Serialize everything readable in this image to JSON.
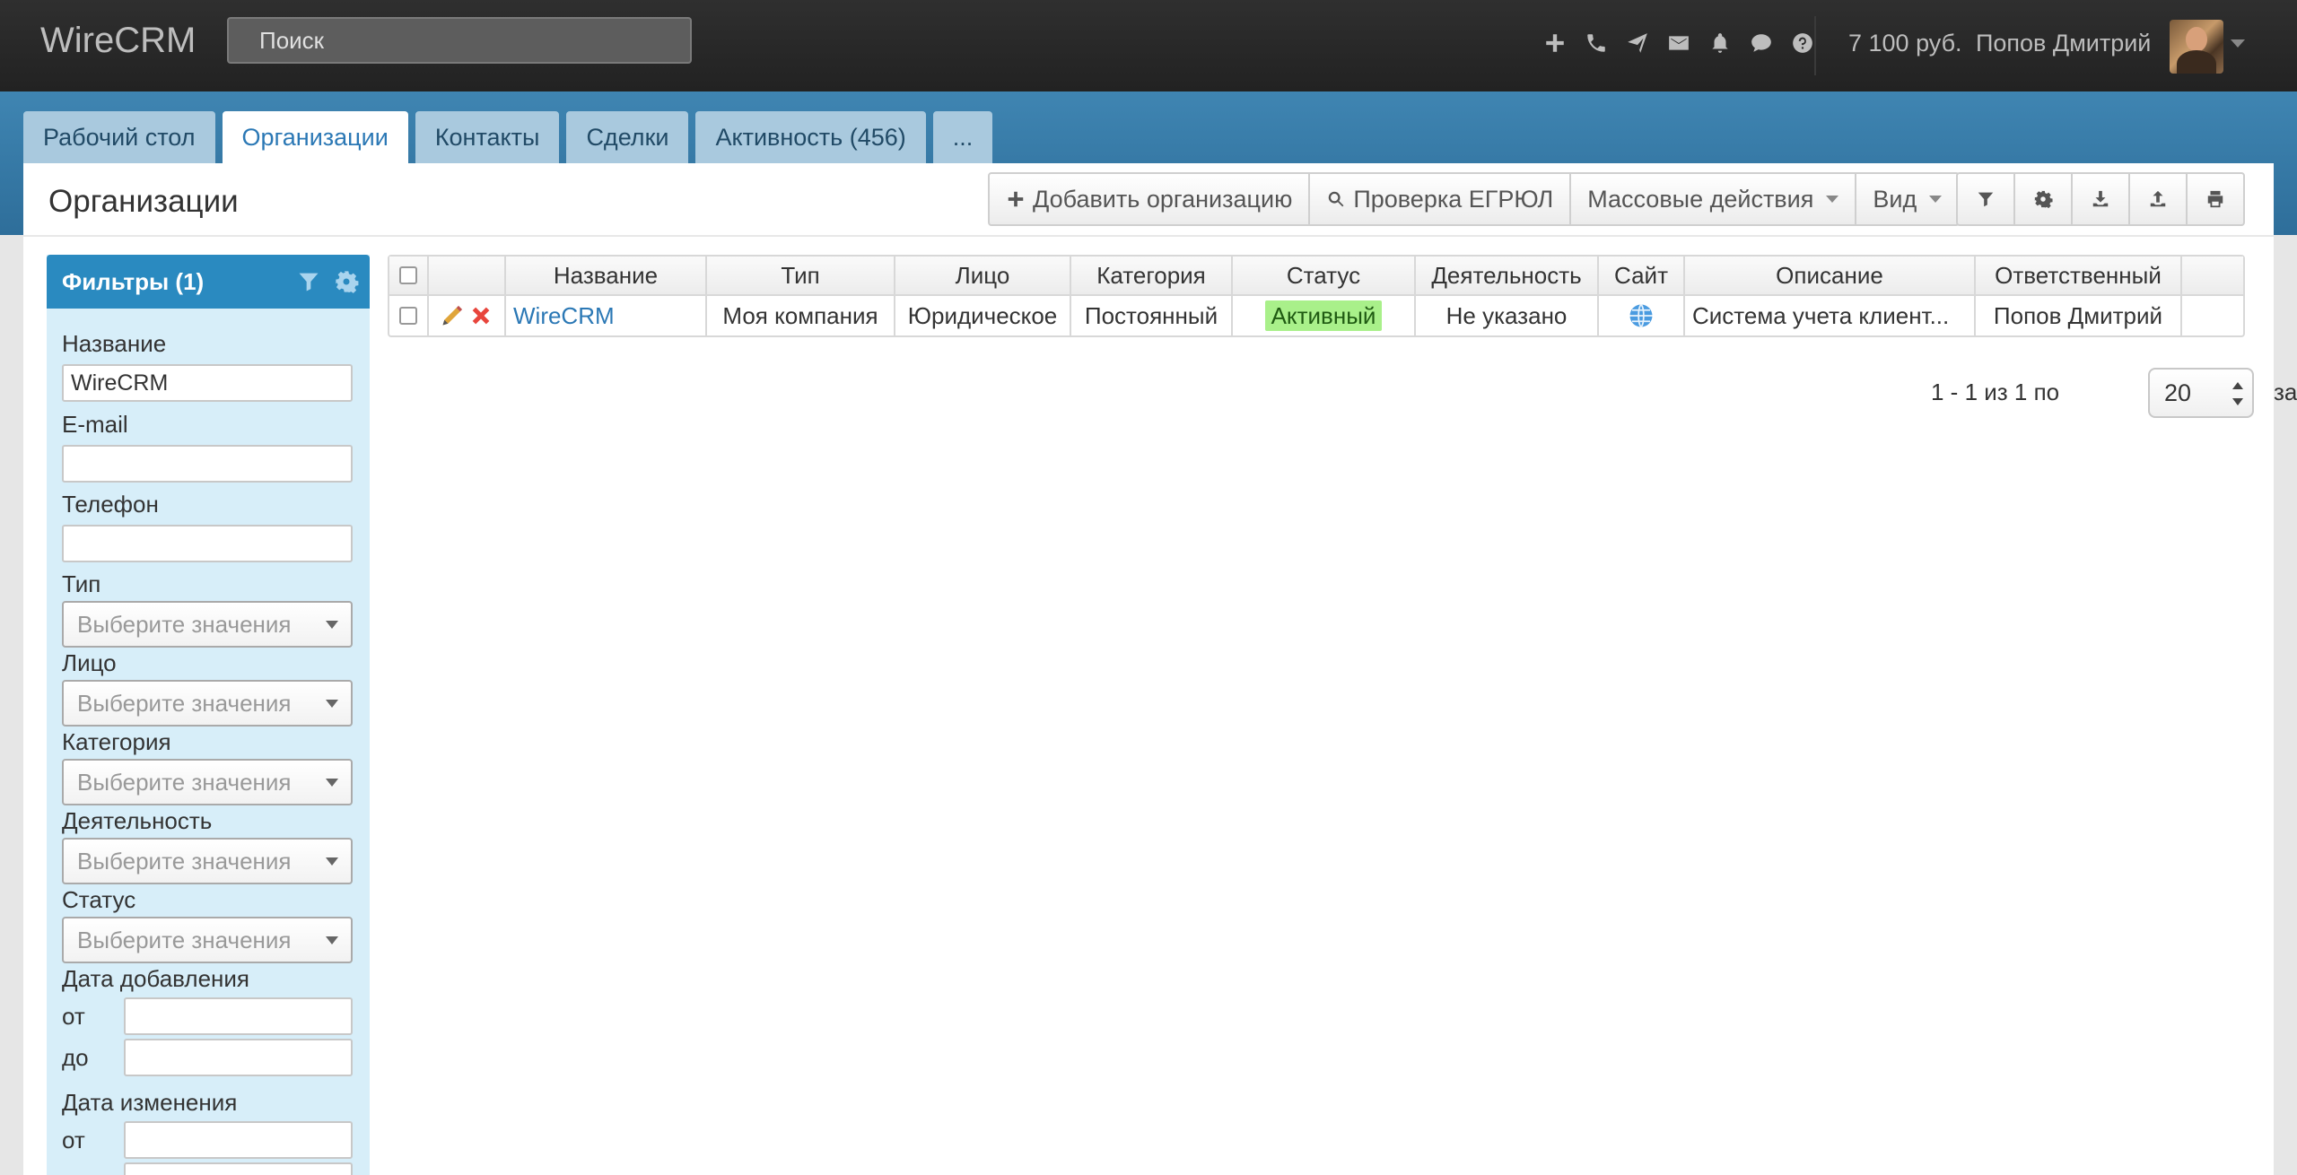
{
  "app": {
    "brand": "WireCRM"
  },
  "topbar": {
    "search_placeholder": "Поиск",
    "icons": [
      "plus-icon",
      "phone-icon",
      "paper-plane-icon",
      "envelope-icon",
      "bell-icon",
      "comment-icon",
      "question-icon"
    ],
    "balance": "7 100 руб.",
    "user_name": "Попов Дмитрий"
  },
  "tabs": [
    {
      "label": "Рабочий стол",
      "active": false
    },
    {
      "label": "Организации",
      "active": true
    },
    {
      "label": "Контакты",
      "active": false
    },
    {
      "label": "Сделки",
      "active": false
    },
    {
      "label": "Активность (456)",
      "active": false
    },
    {
      "label": "...",
      "active": false
    }
  ],
  "page": {
    "title": "Организации"
  },
  "toolbar": {
    "add_label": "Добавить организацию",
    "egrul_label": "Проверка ЕГРЮЛ",
    "mass_label": "Массовые действия",
    "view_label": "Вид",
    "icon_buttons": [
      "filter-icon",
      "gear-icon",
      "download-icon",
      "upload-icon",
      "print-icon"
    ]
  },
  "filters": {
    "title": "Фильтры (1)",
    "name_label": "Название",
    "name_value": "WireCRM",
    "email_label": "E-mail",
    "phone_label": "Телефон",
    "type_label": "Тип",
    "face_label": "Лицо",
    "category_label": "Категория",
    "activity_label": "Деятельность",
    "status_label": "Статус",
    "select_placeholder": "Выберите значения",
    "date_added_label": "Дата добавления",
    "date_changed_label": "Дата изменения",
    "from_label": "от",
    "to_label": "до"
  },
  "table": {
    "columns": [
      "Название",
      "Тип",
      "Лицо",
      "Категория",
      "Статус",
      "Деятельность",
      "Сайт",
      "Описание",
      "Ответственный"
    ],
    "rows": [
      {
        "name": "WireCRM",
        "type": "Моя компания",
        "face": "Юридическое",
        "category": "Постоянный",
        "status": "Активный",
        "activity": "Не указано",
        "site_icon": "globe-icon",
        "description": "Система учета клиент...",
        "responsible": "Попов Дмитрий"
      }
    ]
  },
  "pager": {
    "range_text": "1 - 1 из 1 по",
    "page_size": "20",
    "suffix": "записей"
  },
  "colors": {
    "accent": "#2b78b5",
    "band": "#3a7eab",
    "status_active_bg": "#a9f08a",
    "filter_bg": "#d7eef9",
    "navbar": "#2a2a2a"
  }
}
